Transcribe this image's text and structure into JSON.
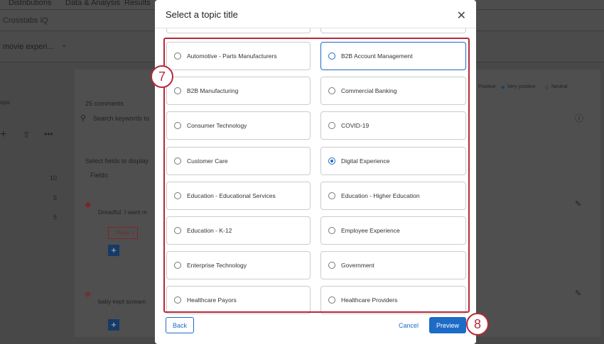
{
  "background": {
    "tabs": [
      "Distributions",
      "Data & Analysis",
      "Results"
    ],
    "subnav": "Crosstabs iQ",
    "dataset_dropdown": "movie experi...",
    "left_label": "opic",
    "counts": [
      "10",
      "5",
      "5"
    ],
    "comments_count": "25 comments",
    "search_placeholder": "Search keywords to",
    "legend": [
      "Positive",
      "Very positive",
      "Neutral"
    ],
    "select_fields": "Select fields to display",
    "fields_dropdown": "Fields:",
    "comments": [
      {
        "text": "Dreadful. I want m",
        "tag": "...Price ×"
      },
      {
        "text": "baby kept scream"
      }
    ]
  },
  "modal": {
    "title": "Select a topic title",
    "options": [
      {
        "label": "Automotive - Parts Manufacturers",
        "selected": false
      },
      {
        "label": "B2B Account Management",
        "selected": false,
        "focused": true
      },
      {
        "label": "B2B Manufacturing",
        "selected": false
      },
      {
        "label": "Commercial Banking",
        "selected": false
      },
      {
        "label": "Consumer Technology",
        "selected": false
      },
      {
        "label": "COVID-19",
        "selected": false
      },
      {
        "label": "Customer Care",
        "selected": false
      },
      {
        "label": "Digital Experience",
        "selected": true
      },
      {
        "label": "Education - Educational Services",
        "selected": false
      },
      {
        "label": "Education - Higher Education",
        "selected": false
      },
      {
        "label": "Education - K-12",
        "selected": false
      },
      {
        "label": "Employee Experience",
        "selected": false
      },
      {
        "label": "Enterprise Technology",
        "selected": false
      },
      {
        "label": "Government",
        "selected": false
      },
      {
        "label": "Healthcare Payors",
        "selected": false
      },
      {
        "label": "Healthcare Providers",
        "selected": false
      }
    ],
    "back_label": "Back",
    "cancel_label": "Cancel",
    "preview_label": "Preview"
  },
  "annotations": [
    "7",
    "8"
  ],
  "colors": {
    "accent": "#1c6bc7",
    "annotation": "#b5293a"
  }
}
